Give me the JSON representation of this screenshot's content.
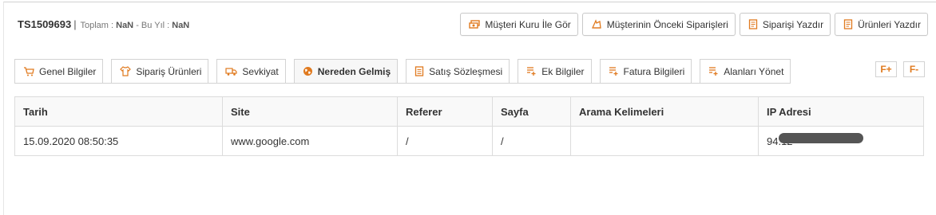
{
  "order": {
    "id": "TS1509693",
    "separator": "|",
    "total_label": "Toplam :",
    "total_value": "NaN",
    "year_label": "- Bu Yıl :",
    "year_value": "NaN"
  },
  "actions": [
    {
      "label": "Müşteri Kuru İle Gör",
      "icon": "currency-exchange-icon"
    },
    {
      "label": "Müşterinin Önceki Siparişleri",
      "icon": "order-history-icon"
    },
    {
      "label": "Siparişi Yazdır",
      "icon": "print-order-icon"
    },
    {
      "label": "Ürünleri Yazdır",
      "icon": "print-products-icon"
    }
  ],
  "tabs": [
    {
      "label": "Genel Bilgiler",
      "icon": "cart-icon"
    },
    {
      "label": "Sipariş Ürünleri",
      "icon": "shirt-icon"
    },
    {
      "label": "Sevkiyat",
      "icon": "truck-icon"
    },
    {
      "label": "Nereden Gelmiş",
      "icon": "globe-icon",
      "active": true
    },
    {
      "label": "Satış Sözleşmesi",
      "icon": "document-icon"
    },
    {
      "label": "Ek Bilgiler",
      "icon": "add-list-icon"
    },
    {
      "label": "Fatura Bilgileri",
      "icon": "add-list-icon"
    },
    {
      "label": "Alanları Yönet",
      "icon": "add-list-icon"
    }
  ],
  "font_controls": {
    "increase": "F+",
    "decrease": "F-"
  },
  "table": {
    "columns": [
      "Tarih",
      "Site",
      "Referer",
      "Sayfa",
      "Arama Kelimeleri",
      "IP Adresi"
    ],
    "rows": [
      {
        "tarih": "15.09.2020 08:50:35",
        "site": "www.google.com",
        "referer": "/",
        "sayfa": "/",
        "arama": "",
        "ip": "94.12"
      }
    ]
  },
  "colors": {
    "accent": "#e07a1f"
  }
}
